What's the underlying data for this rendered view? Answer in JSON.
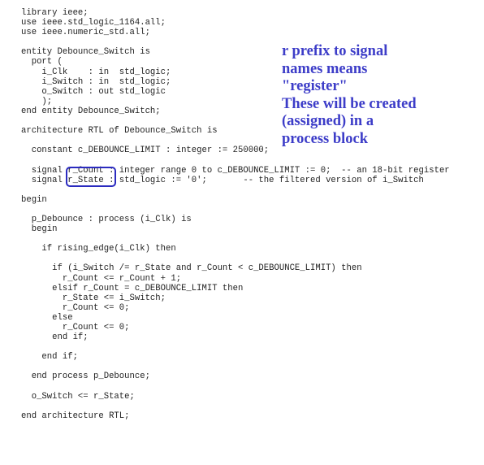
{
  "code": {
    "lines": [
      "library ieee;",
      "use ieee.std_logic_1164.all;",
      "use ieee.numeric_std.all;",
      "",
      "entity Debounce_Switch is",
      "  port (",
      "    i_Clk    : in  std_logic;",
      "    i_Switch : in  std_logic;",
      "    o_Switch : out std_logic",
      "    );",
      "end entity Debounce_Switch;",
      "",
      "architecture RTL of Debounce_Switch is",
      "",
      "  constant c_DEBOUNCE_LIMIT : integer := 250000;",
      "",
      "  signal r_Count : integer range 0 to c_DEBOUNCE_LIMIT := 0;  -- an 18-bit register",
      "  signal r_State : std_logic := '0';       -- the filtered version of i_Switch",
      "",
      "begin",
      "",
      "  p_Debounce : process (i_Clk) is",
      "  begin",
      "",
      "    if rising_edge(i_Clk) then",
      "",
      "      if (i_Switch /= r_State and r_Count < c_DEBOUNCE_LIMIT) then",
      "        r_Count <= r_Count + 1;",
      "      elsif r_Count = c_DEBOUNCE_LIMIT then",
      "        r_State <= i_Switch;",
      "        r_Count <= 0;",
      "      else",
      "        r_Count <= 0;",
      "      end if;",
      "",
      "    end if;",
      "",
      "  end process p_Debounce;",
      "",
      "  o_Switch <= r_State;",
      "",
      "end architecture RTL;"
    ]
  },
  "annotation": {
    "text": "r prefix to signal\nnames means\n\"register\"\nThese will be created\n(assigned) in a\nprocess block",
    "color": "#3d3dc8",
    "box_color": "#2b2bbf"
  }
}
